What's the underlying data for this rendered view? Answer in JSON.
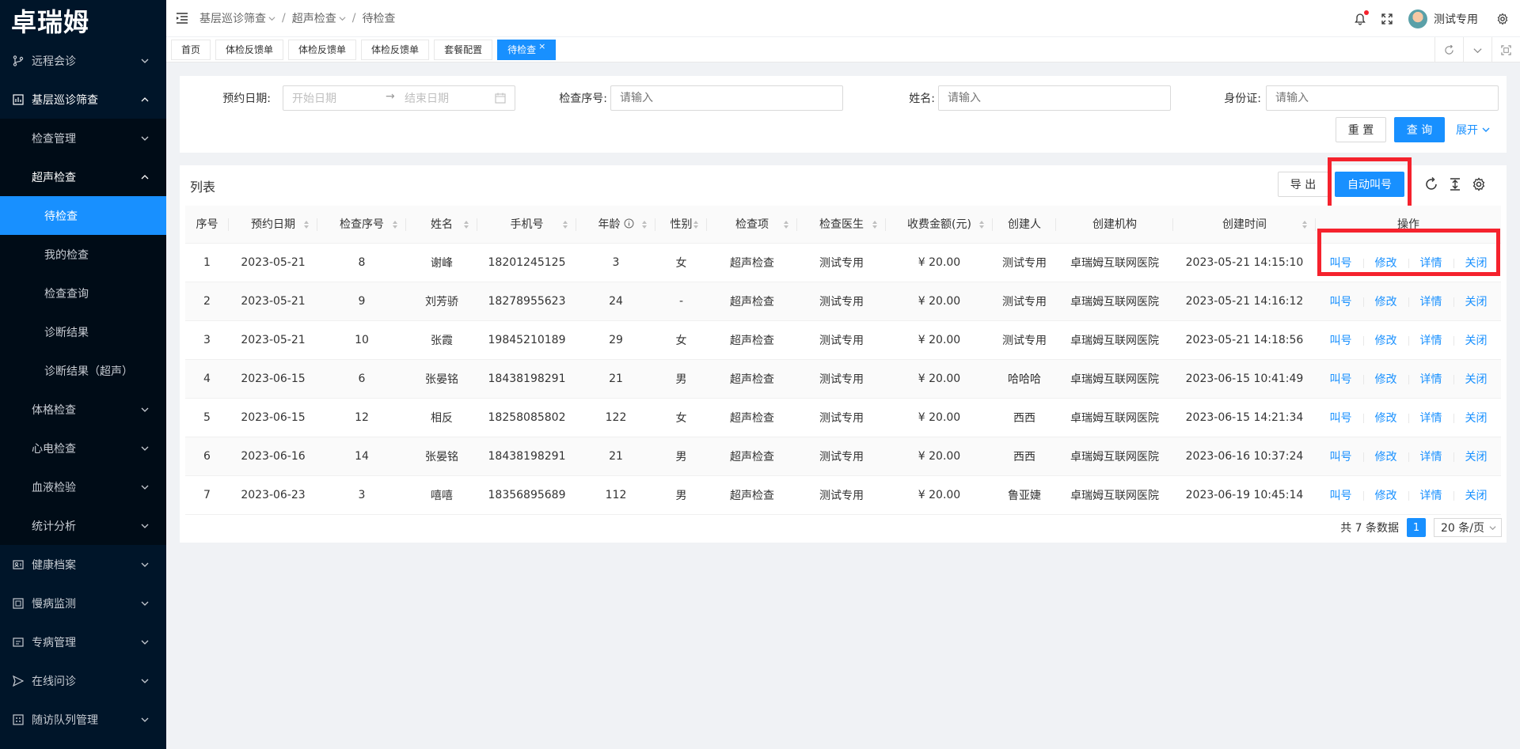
{
  "logo": "卓瑞姆",
  "sidebar": {
    "items": [
      {
        "label": "远程会诊",
        "icon": "branch-icon"
      },
      {
        "label": "基层巡诊筛查",
        "icon": "chart-box-icon"
      },
      {
        "label": "检查管理"
      },
      {
        "label": "超声检查"
      },
      {
        "label": "待检查"
      },
      {
        "label": "我的检查"
      },
      {
        "label": "检查查询"
      },
      {
        "label": "诊断结果"
      },
      {
        "label": "诊断结果（超声）"
      },
      {
        "label": "体格检查"
      },
      {
        "label": "心电检查"
      },
      {
        "label": "血液检验"
      },
      {
        "label": "统计分析"
      },
      {
        "label": "健康档案",
        "icon": "id-card-icon"
      },
      {
        "label": "慢病监测",
        "icon": "monitor-icon"
      },
      {
        "label": "专病管理",
        "icon": "folder-icon"
      },
      {
        "label": "在线问诊",
        "icon": "send-icon"
      },
      {
        "label": "随访队列管理",
        "icon": "apps-icon"
      }
    ]
  },
  "header": {
    "breadcrumb": [
      "基层巡诊筛查",
      "超声检查",
      "待检查"
    ],
    "username": "测试专用"
  },
  "tabs": [
    "首页",
    "体检反馈单",
    "体检反馈单",
    "体检反馈单",
    "套餐配置",
    "待检查"
  ],
  "search": {
    "date_label": "预约日期:",
    "start_placeholder": "开始日期",
    "end_placeholder": "结束日期",
    "seq_label": "检查序号:",
    "seq_placeholder": "请输入",
    "name_label": "姓名:",
    "name_placeholder": "请输入",
    "id_label": "身份证:",
    "id_placeholder": "请输入",
    "reset": "重 置",
    "query": "查 询",
    "expand": "展开"
  },
  "list": {
    "title": "列表",
    "export": "导 出",
    "auto_call": "自动叫号",
    "columns": [
      "序号",
      "预约日期",
      "检查序号",
      "姓名",
      "手机号",
      "年龄",
      "性别",
      "检查项",
      "检查医生",
      "收费金额(元)",
      "创建人",
      "创建机构",
      "创建时间",
      "操作"
    ],
    "actions": [
      "叫号",
      "修改",
      "详情",
      "关闭"
    ],
    "rows": [
      {
        "idx": "1",
        "date": "2023-05-21",
        "seq": "8",
        "name": "谢峰",
        "phone": "18201245125",
        "age": "3",
        "sex": "女",
        "item": "超声检查",
        "doctor": "测试专用",
        "fee": "¥ 20.00",
        "creator": "测试专用",
        "org": "卓瑞姆互联网医院",
        "ctime": "2023-05-21 14:15:10"
      },
      {
        "idx": "2",
        "date": "2023-05-21",
        "seq": "9",
        "name": "刘芳骄",
        "phone": "18278955623",
        "age": "24",
        "sex": "-",
        "item": "超声检查",
        "doctor": "测试专用",
        "fee": "¥ 20.00",
        "creator": "测试专用",
        "org": "卓瑞姆互联网医院",
        "ctime": "2023-05-21 14:16:12"
      },
      {
        "idx": "3",
        "date": "2023-05-21",
        "seq": "10",
        "name": "张霞",
        "phone": "19845210189",
        "age": "29",
        "sex": "女",
        "item": "超声检查",
        "doctor": "测试专用",
        "fee": "¥ 20.00",
        "creator": "测试专用",
        "org": "卓瑞姆互联网医院",
        "ctime": "2023-05-21 14:18:56"
      },
      {
        "idx": "4",
        "date": "2023-06-15",
        "seq": "6",
        "name": "张晏铭",
        "phone": "18438198291",
        "age": "21",
        "sex": "男",
        "item": "超声检查",
        "doctor": "测试专用",
        "fee": "¥ 20.00",
        "creator": "哈哈哈",
        "org": "卓瑞姆互联网医院",
        "ctime": "2023-06-15 10:41:49"
      },
      {
        "idx": "5",
        "date": "2023-06-15",
        "seq": "12",
        "name": "相反",
        "phone": "18258085802",
        "age": "122",
        "sex": "女",
        "item": "超声检查",
        "doctor": "测试专用",
        "fee": "¥ 20.00",
        "creator": "西西",
        "org": "卓瑞姆互联网医院",
        "ctime": "2023-06-15 14:21:34"
      },
      {
        "idx": "6",
        "date": "2023-06-16",
        "seq": "14",
        "name": "张晏铭",
        "phone": "18438198291",
        "age": "21",
        "sex": "男",
        "item": "超声检查",
        "doctor": "测试专用",
        "fee": "¥ 20.00",
        "creator": "西西",
        "org": "卓瑞姆互联网医院",
        "ctime": "2023-06-16 10:37:24"
      },
      {
        "idx": "7",
        "date": "2023-06-23",
        "seq": "3",
        "name": "嘻嘻",
        "phone": "18356895689",
        "age": "112",
        "sex": "男",
        "item": "超声检查",
        "doctor": "测试专用",
        "fee": "¥ 20.00",
        "creator": "鲁亚婕",
        "org": "卓瑞姆互联网医院",
        "ctime": "2023-06-19 10:45:14"
      }
    ]
  },
  "pager": {
    "total": "共 7 条数据",
    "page": "1",
    "size": "20 条/页"
  },
  "colors": {
    "primary": "#1890ff",
    "sidebar": "#001529",
    "highlight": "#f5222d"
  }
}
